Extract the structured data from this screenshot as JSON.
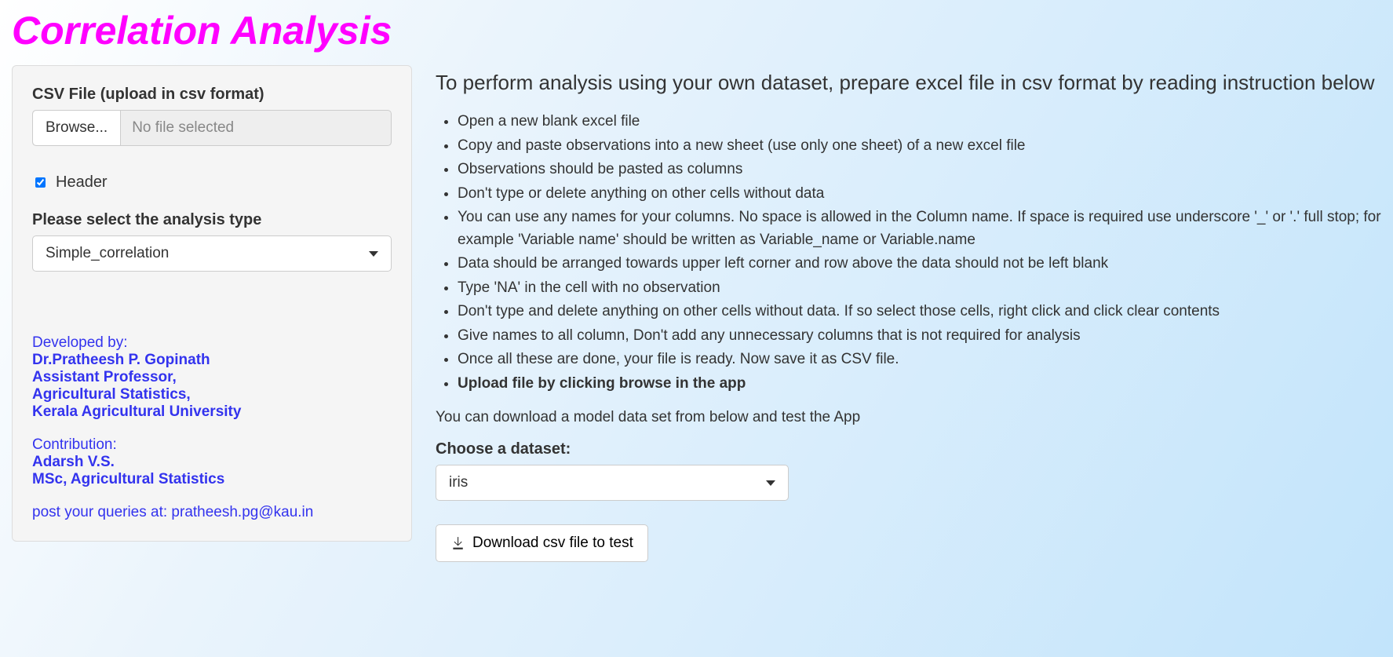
{
  "title": "Correlation Analysis",
  "sidebar": {
    "file_label": "CSV File (upload in csv format)",
    "browse_label": "Browse...",
    "file_status": "No file selected",
    "header_checkbox_label": "Header",
    "header_checked": true,
    "analysis_label": "Please select the analysis type",
    "analysis_selected": "Simple_correlation",
    "credits": {
      "developed_by": "Developed by:",
      "name": "Dr.Pratheesh P. Gopinath",
      "role": "Assistant Professor,",
      "dept": "Agricultural Statistics,",
      "uni": "Kerala Agricultural University",
      "contribution": "Contribution:",
      "contrib_name": "Adarsh V.S.",
      "contrib_role": "MSc, Agricultural Statistics",
      "queries": "post your queries at: pratheesh.pg@kau.in"
    }
  },
  "main": {
    "heading": "To perform analysis using your own dataset, prepare excel file in csv format by reading instruction below",
    "instructions": [
      "Open a new blank excel file",
      "Copy and paste observations into a new sheet (use only one sheet) of a new excel file",
      "Observations should be pasted as columns",
      "Don't type or delete anything on other cells without data",
      "You can use any names for your columns. No space is allowed in the Column name. If space is required use underscore '_' or '.' full stop; for example 'Variable name' should be written as Variable_name or Variable.name",
      "Data should be arranged towards upper left corner and row above the data should not be left blank",
      "Type 'NA' in the cell with no observation",
      "Don't type and delete anything on other cells without data. If so select those cells, right click and click clear contents",
      "Give names to all column, Don't add any unnecessary columns that is not required for analysis",
      "Once all these are done, your file is ready. Now save it as CSV file.",
      "Upload file by clicking browse in the app"
    ],
    "download_note": "You can download a model data set from below and test the App",
    "dataset_label": "Choose a dataset:",
    "dataset_selected": "iris",
    "download_button": "Download csv file to test"
  }
}
